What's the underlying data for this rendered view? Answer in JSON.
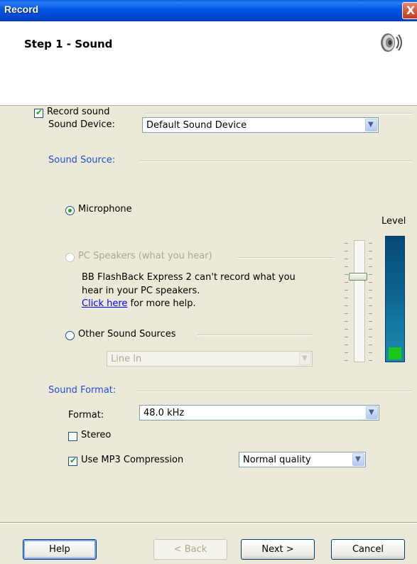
{
  "window": {
    "title": "Record",
    "close_label": "X"
  },
  "header": {
    "step_title": "Step 1 - Sound",
    "icon": "speaker-icon"
  },
  "record_sound": {
    "label": "Record sound",
    "checked": true
  },
  "sound_device": {
    "label": "Sound Device:",
    "value": "Default Sound Device"
  },
  "sound_source": {
    "heading": "Sound Source:",
    "microphone_label": "Microphone",
    "microphone_selected": true,
    "pc_speakers_label": "PC Speakers (what you hear)",
    "pc_speakers_enabled": false,
    "warning_line1": "BB FlashBack Express 2 can't record what you",
    "warning_line2": "hear in your PC speakers.",
    "link_text": "Click here",
    "link_suffix": " for more help.",
    "other_label": "Other Sound Sources",
    "other_value": "Line In"
  },
  "level": {
    "label": "Level",
    "slider_fraction": 0.31,
    "meter_fraction": 0.12
  },
  "sound_format": {
    "heading": "Sound Format:",
    "format_label": "Format:",
    "format_value": "48.0 kHz",
    "stereo_label": "Stereo",
    "stereo_checked": false,
    "mp3_label": "Use MP3 Compression",
    "mp3_checked": true,
    "quality_value": "Normal quality"
  },
  "buttons": {
    "help": "Help",
    "back": "< Back",
    "next": "Next >",
    "cancel": "Cancel"
  },
  "colors": {
    "accent_blue": "#1F4FD6",
    "check_green": "#21A121",
    "meter_green": "#19C719"
  }
}
